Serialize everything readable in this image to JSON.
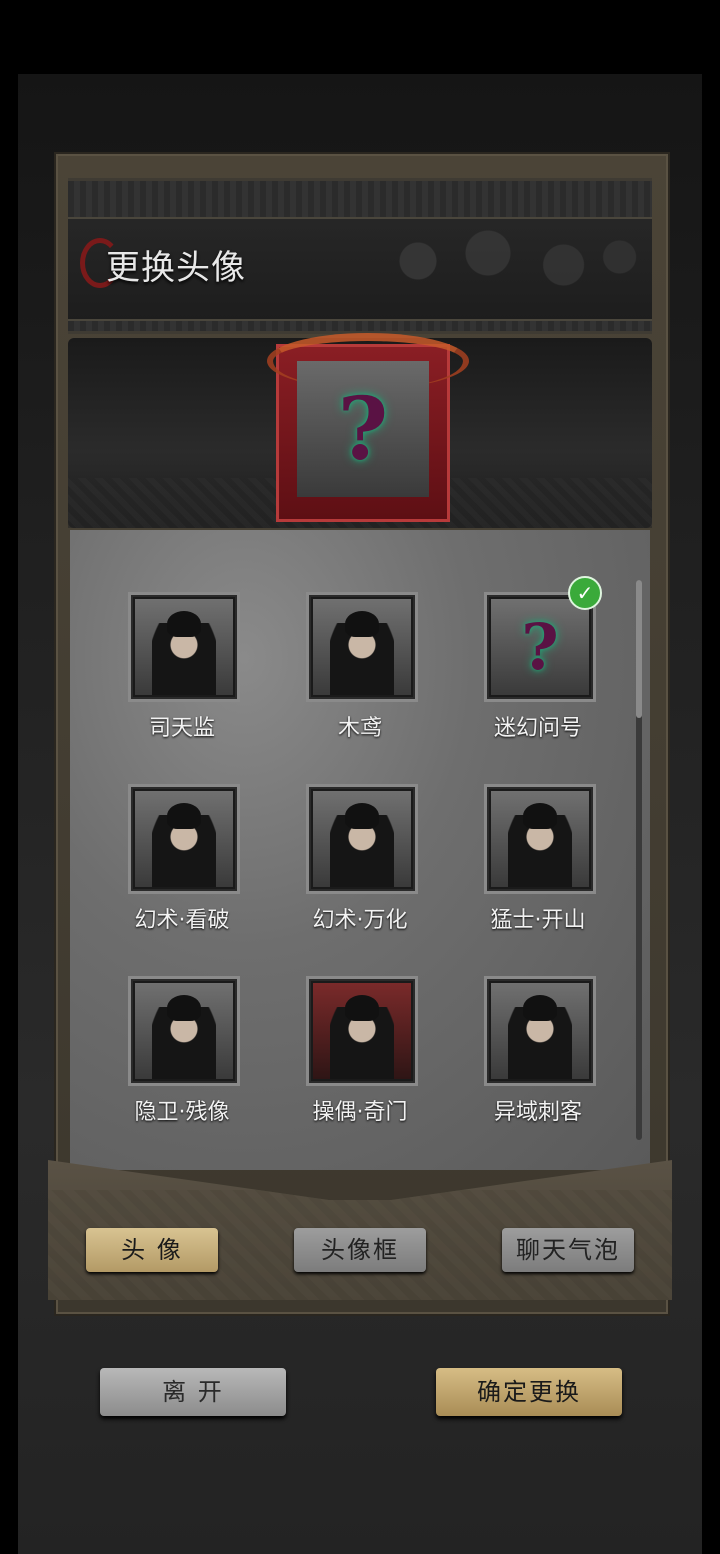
{
  "header": {
    "title": "更换头像"
  },
  "preview": {
    "icon": "question-mark-icon",
    "accent": "#1fa876"
  },
  "avatars": [
    {
      "label": "司天监",
      "selected": false
    },
    {
      "label": "木鸢",
      "selected": false
    },
    {
      "label": "迷幻问号",
      "selected": true
    },
    {
      "label": "幻术·看破",
      "selected": false
    },
    {
      "label": "幻术·万化",
      "selected": false
    },
    {
      "label": "猛士·开山",
      "selected": false
    },
    {
      "label": "隐卫·残像",
      "selected": false
    },
    {
      "label": "操偶·奇门",
      "selected": false
    },
    {
      "label": "异域刺客",
      "selected": false
    }
  ],
  "tabs": [
    {
      "label": "头 像",
      "active": true
    },
    {
      "label": "头像框",
      "active": false
    },
    {
      "label": "聊天气泡",
      "active": false
    }
  ],
  "actions": {
    "leave_label": "离 开",
    "confirm_label": "确定更换"
  },
  "colors": {
    "selected_badge": "#3aaa3a",
    "confirm_gold": "#c7ad74",
    "frame_red": "#8a1e24"
  }
}
